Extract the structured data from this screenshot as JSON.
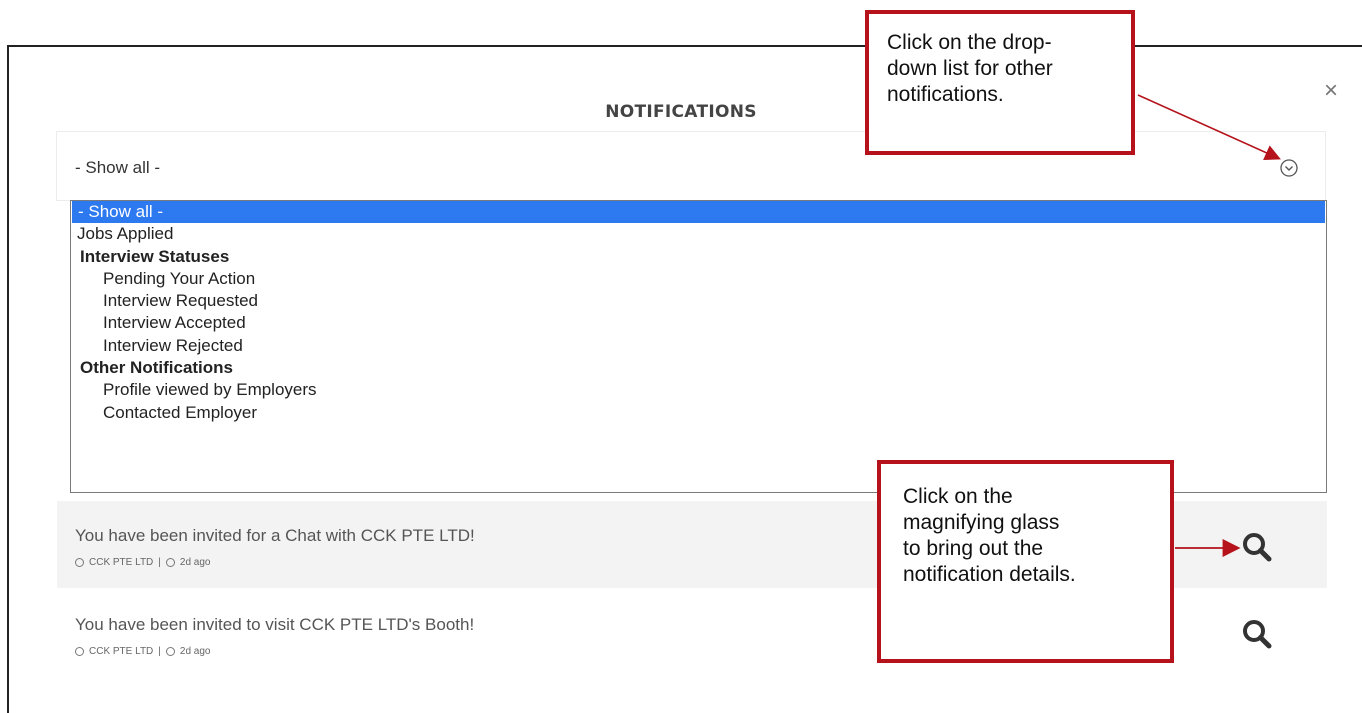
{
  "modal": {
    "title": "NOTIFICATIONS",
    "close_label": "×"
  },
  "filter": {
    "selected_value": "- Show all -",
    "options": [
      {
        "label": "- Show all -",
        "kind": "option",
        "selected": true
      },
      {
        "label": "Jobs Applied",
        "kind": "option"
      },
      {
        "label": "Interview Statuses",
        "kind": "group"
      },
      {
        "label": "Pending Your Action",
        "kind": "sub"
      },
      {
        "label": "Interview Requested",
        "kind": "sub"
      },
      {
        "label": "Interview Accepted",
        "kind": "sub"
      },
      {
        "label": "Interview Rejected",
        "kind": "sub"
      },
      {
        "label": "Other Notifications",
        "kind": "group"
      },
      {
        "label": "Profile viewed by Employers",
        "kind": "sub"
      },
      {
        "label": "Contacted Employer",
        "kind": "sub"
      }
    ]
  },
  "notifications": [
    {
      "title": "You have been invited for a Chat with CCK PTE LTD!",
      "company": "CCK PTE LTD",
      "separator": "|",
      "time": "2d ago"
    },
    {
      "title": "You have been invited to visit CCK PTE LTD's Booth!",
      "company": "CCK PTE LTD",
      "separator": "|",
      "time": "2d ago"
    }
  ],
  "callouts": {
    "dropdown_hint": {
      "lines": [
        "Click on the drop-",
        "down list for other",
        "notifications."
      ]
    },
    "search_hint": {
      "lines": [
        "Click on the",
        "magnifying glass",
        "to bring out the",
        "notification details."
      ]
    }
  },
  "colors": {
    "selected_option": "#2c79f0",
    "callout_border": "#b5121b",
    "annotation_arrow": "#b5121b",
    "search_icon": "#333333"
  },
  "icons": {
    "close": "close-icon",
    "dropdown": "chevron-down-circle-icon",
    "search": "search-icon",
    "company": "user-icon",
    "time": "clock-icon"
  }
}
